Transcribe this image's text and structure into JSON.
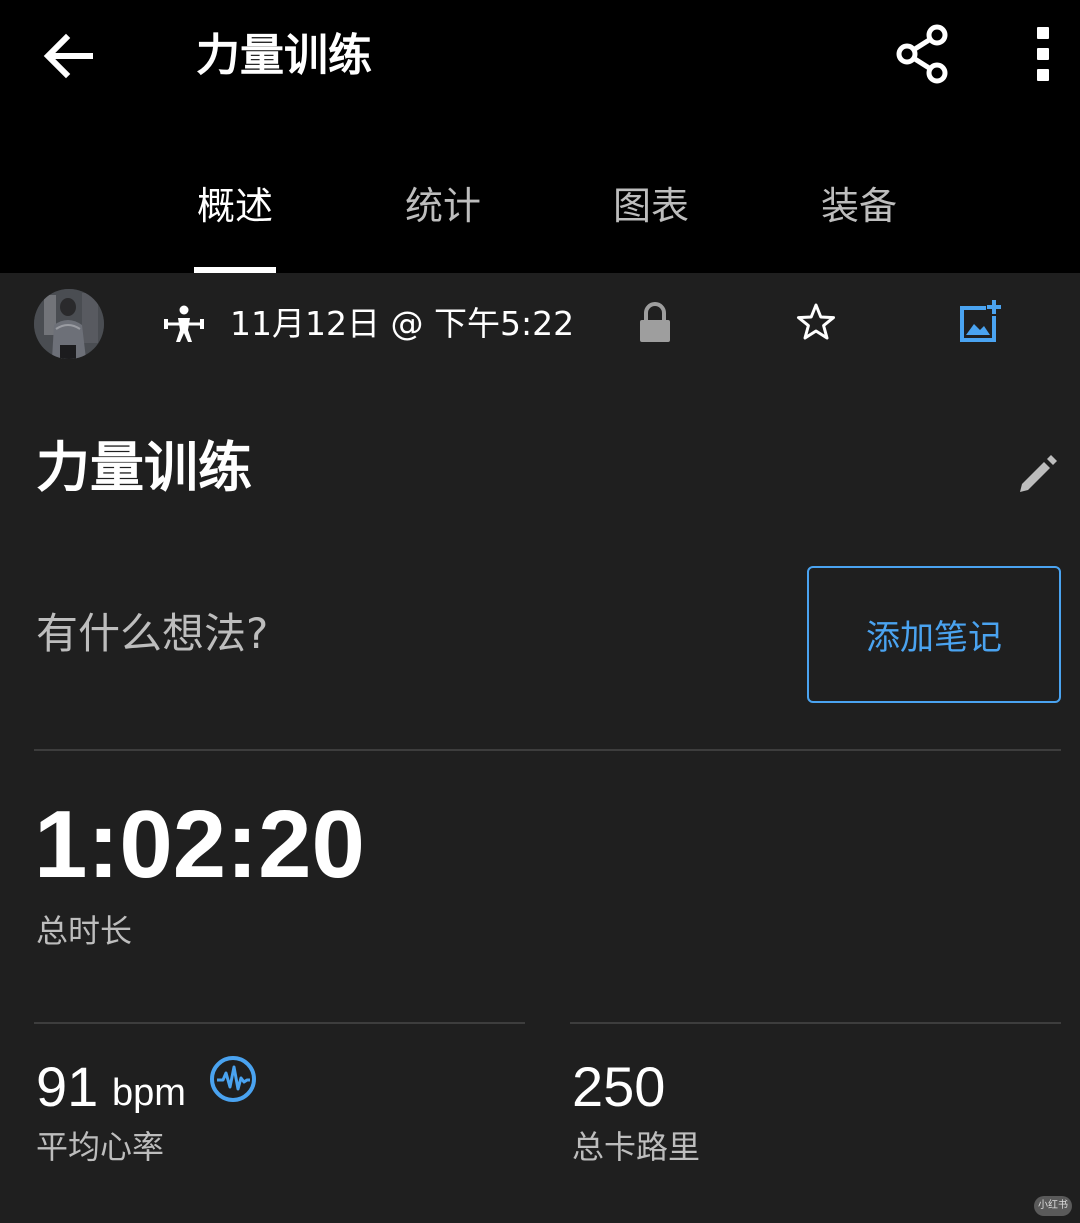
{
  "header": {
    "title": "力量训练",
    "back_icon": "arrow-left-icon",
    "share_icon": "share-icon",
    "more_icon": "more-vertical-icon"
  },
  "tabs": [
    {
      "label": "概述",
      "active": true
    },
    {
      "label": "统计",
      "active": false
    },
    {
      "label": "图表",
      "active": false
    },
    {
      "label": "装备",
      "active": false
    }
  ],
  "meta": {
    "activity_icon": "strength-training-icon",
    "date": "11月12日 @ 下午5:22",
    "lock_icon": "lock-icon",
    "star_icon": "star-outline-icon",
    "add_photo_icon": "add-photo-icon"
  },
  "activity": {
    "title": "力量训练",
    "edit_icon": "pencil-icon"
  },
  "note": {
    "prompt": "有什么想法?",
    "button_label": "添加笔记"
  },
  "stats": {
    "duration": {
      "value": "1:02:20",
      "label": "总时长"
    },
    "heart_rate": {
      "value": "91",
      "unit": "bpm",
      "label": "平均心率",
      "icon": "heart-rate-icon"
    },
    "calories": {
      "value": "250",
      "label": "总卡路里"
    }
  },
  "colors": {
    "accent": "#4aa3f0",
    "background": "#1f1f1f",
    "header_background": "#000000",
    "secondary_text": "#bdbdbd"
  },
  "watermark": "小红书"
}
